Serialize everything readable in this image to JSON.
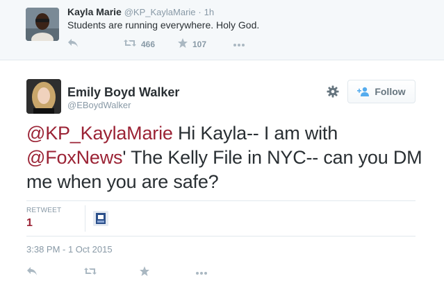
{
  "parent_tweet": {
    "name": "Kayla Marie",
    "handle": "@KP_KaylaMarie",
    "separator": "·",
    "time": "1h",
    "text": "Students are running everywhere. Holy God.",
    "retweet_count": "466",
    "favorite_count": "107"
  },
  "main_tweet": {
    "name": "Emily Boyd Walker",
    "handle": "@EBoydWalker",
    "follow_label": "Follow",
    "text_parts": {
      "mention1": "@KP_KaylaMarie",
      "text1": " Hi Kayla-- I am with ",
      "mention2": "@FoxNews",
      "text2": "' The Kelly File in NYC-- can you DM me when you are safe?"
    },
    "stats": {
      "retweet_label": "RETWEET",
      "retweet_count": "1"
    },
    "timestamp": "3:38 PM - 1 Oct 2015"
  },
  "colors": {
    "accent": "#9b2335",
    "muted": "#8899a6",
    "text": "#292f33",
    "border": "#e1e8ed"
  },
  "icons": [
    "reply-icon",
    "retweet-icon",
    "favorite-icon",
    "more-icon",
    "gear-icon",
    "follow-person-icon"
  ]
}
